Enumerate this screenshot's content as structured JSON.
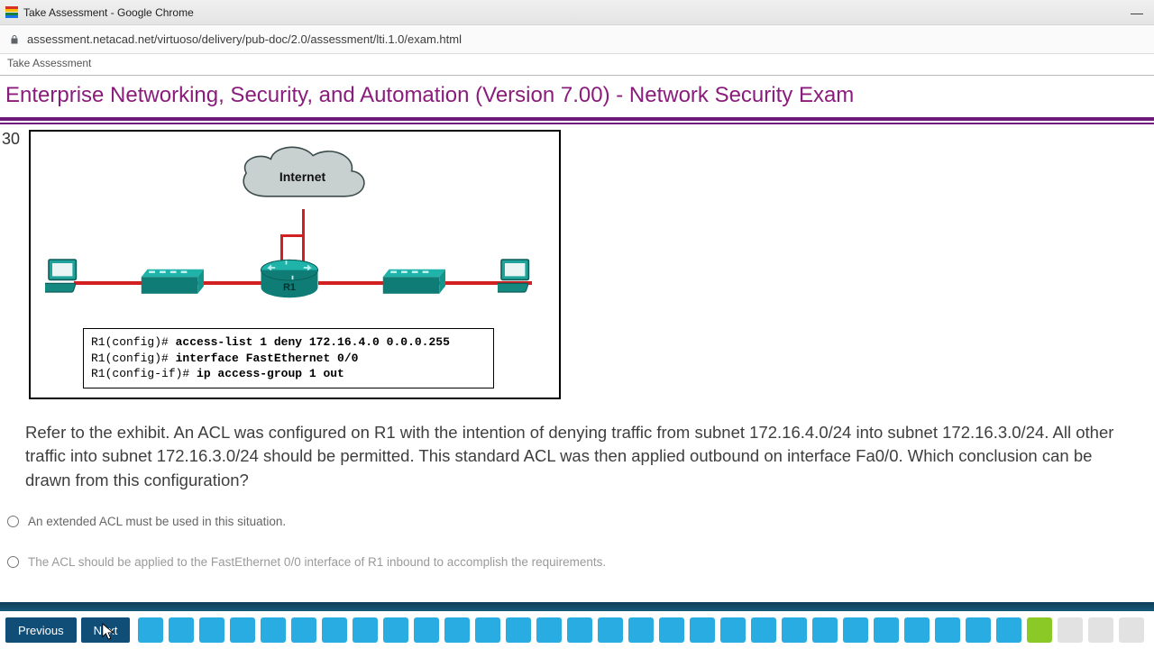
{
  "window": {
    "title": "Take Assessment - Google Chrome",
    "minimize": "—"
  },
  "url": "assessment.netacad.net/virtuoso/delivery/pub-doc/2.0/assessment/lti.1.0/exam.html",
  "page_tab": "Take Assessment",
  "exam_title": "Enterprise Networking, Security, and Automation (Version 7.00) - Network Security Exam",
  "question": {
    "number": "30",
    "diagram": {
      "cloud_label": "Internet",
      "router_label": "R1"
    },
    "config_lines": {
      "p1": "R1(config)# ",
      "c1": "access-list 1 deny 172.16.4.0 0.0.0.255",
      "p2": "R1(config)# ",
      "c2": "interface FastEthernet 0/0",
      "p3": "R1(config-if)# ",
      "c3": "ip access-group 1 out"
    },
    "text": "Refer to the exhibit. An ACL was configured on R1 with the intention of denying traffic from subnet 172.16.4.0/24 into subnet 172.16.3.0/24. All other traffic into subnet 172.16.3.0/24 should be permitted. This standard ACL was then applied outbound on interface Fa0/0. Which conclusion can be drawn from this configuration?",
    "answers": {
      "a1": "An extended ACL must be used in this situation.",
      "a2": "The ACL should be applied to the FastEthernet 0/0 interface of R1 inbound to accomplish the requirements."
    }
  },
  "nav": {
    "previous": "Previous",
    "next": "Next",
    "boxes": [
      "answered",
      "answered",
      "answered",
      "answered",
      "answered",
      "answered",
      "answered",
      "answered",
      "answered",
      "answered",
      "answered",
      "answered",
      "answered",
      "answered",
      "answered",
      "answered",
      "answered",
      "answered",
      "answered",
      "answered",
      "answered",
      "answered",
      "answered",
      "answered",
      "answered",
      "answered",
      "answered",
      "answered",
      "answered",
      "current",
      "empty",
      "empty",
      "empty"
    ]
  }
}
